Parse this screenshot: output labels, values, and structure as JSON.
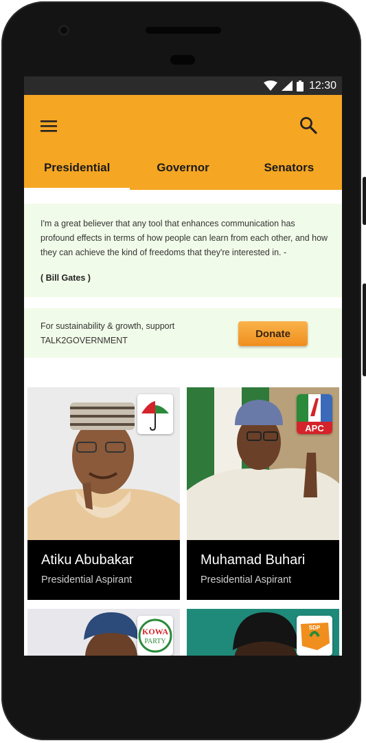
{
  "status_bar": {
    "time": "12:30"
  },
  "tabs": [
    {
      "label": "Presidential",
      "active": true
    },
    {
      "label": "Governor",
      "active": false
    },
    {
      "label": "Senators",
      "active": false
    }
  ],
  "quote": {
    "text": "I'm a great believer that any tool that enhances communication has profound effects in terms of how people can learn from each other, and how they can achieve the kind of freedoms that they're interested in. -",
    "author": "( Bill Gates )"
  },
  "donate": {
    "line1": "For sustainability & growth, support",
    "line2": "TALK2GOVERNMENT",
    "button_label": "Donate"
  },
  "candidates": [
    {
      "name": "Atiku Abubakar",
      "role": "Presidential Aspirant",
      "party_logo": "pdp-logo"
    },
    {
      "name": "Muhamad Buhari",
      "role": "Presidential Aspirant",
      "party_logo": "apc-logo"
    },
    {
      "name": "",
      "role": "",
      "party_logo": "kowa-party-logo"
    },
    {
      "name": "",
      "role": "",
      "party_logo": "sdp-logo"
    }
  ],
  "party_logos": {
    "apc_text": "APC",
    "kowa_text_1": "KOWA",
    "kowa_text_2": "PARTY",
    "sdp_text": "SDP"
  },
  "colors": {
    "accent": "#f5a623",
    "card_bg": "#f1fbe9",
    "caption_bg": "#000000"
  }
}
